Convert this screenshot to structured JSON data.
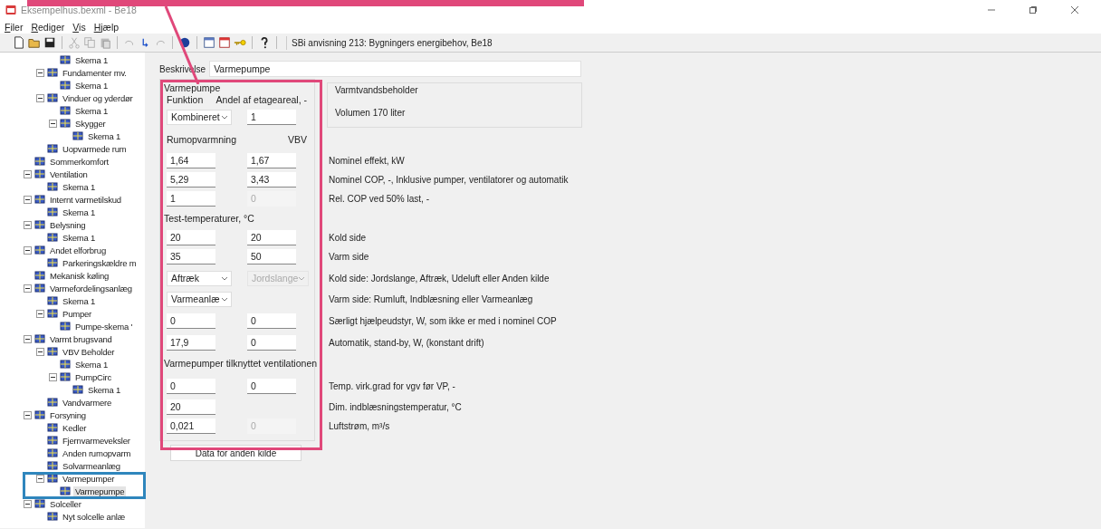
{
  "window": {
    "title": "Eksempelhus.bexml - Be18"
  },
  "menu": [
    "Filer",
    "Rediger",
    "Vis",
    "Hjælp"
  ],
  "toolbar": {
    "reference": "SBi anvisning 213: Bygningers energibehov, Be18"
  },
  "tree": {
    "items": [
      {
        "children": [
          {
            "children": [
              {
                "label": "Skema 1",
                "selected": false
              }
            ]
          },
          {
            "label": "Fundamenter mv.",
            "expanded": true,
            "selected": false,
            "children": [
              {
                "label": "Skema 1",
                "selected": false
              }
            ]
          },
          {
            "label": "Vinduer og yderdør",
            "expanded": true,
            "selected": false,
            "children": [
              {
                "label": "Skema 1",
                "selected": false
              },
              {
                "label": "Skygger",
                "expanded": true,
                "selected": false,
                "children": [
                  {
                    "label": "Skema 1",
                    "selected": false
                  }
                ]
              }
            ]
          },
          {
            "label": "Uopvarmede rum",
            "selected": false
          }
        ]
      },
      {
        "label": "Sommerkomfort",
        "selected": false
      },
      {
        "label": "Ventilation",
        "expanded": true,
        "selected": false,
        "children": [
          {
            "label": "Skema 1",
            "selected": false
          }
        ]
      },
      {
        "label": "Internt varmetilskud",
        "expanded": true,
        "selected": false,
        "children": [
          {
            "label": "Skema 1",
            "selected": false
          }
        ]
      },
      {
        "label": "Belysning",
        "expanded": true,
        "selected": false,
        "children": [
          {
            "label": "Skema 1",
            "selected": false
          }
        ]
      },
      {
        "label": "Andet elforbrug",
        "expanded": true,
        "selected": false,
        "children": [
          {
            "label": "Parkeringskældre m",
            "selected": false
          }
        ]
      },
      {
        "label": "Mekanisk køling",
        "selected": false
      },
      {
        "label": "Varmefordelingsanlæg",
        "expanded": true,
        "selected": false,
        "children": [
          {
            "label": "Skema 1",
            "selected": false
          },
          {
            "label": "Pumper",
            "expanded": true,
            "selected": false,
            "children": [
              {
                "label": "Pumpe-skema '",
                "selected": false
              }
            ]
          }
        ]
      },
      {
        "label": "Varmt brugsvand",
        "expanded": true,
        "selected": false,
        "children": [
          {
            "label": "VBV Beholder",
            "expanded": true,
            "selected": false,
            "children": [
              {
                "label": "Skema 1",
                "selected": false
              },
              {
                "label": "PumpCirc",
                "expanded": true,
                "selected": false,
                "children": [
                  {
                    "label": "Skema 1",
                    "selected": false
                  }
                ]
              }
            ]
          },
          {
            "label": "Vandvarmere",
            "selected": false
          }
        ]
      },
      {
        "label": "Forsyning",
        "expanded": true,
        "selected": false,
        "children": [
          {
            "label": "Kedler",
            "selected": false
          },
          {
            "label": "Fjernvarmeveksler",
            "selected": false
          },
          {
            "label": "Anden rumopvarm",
            "selected": false
          },
          {
            "label": "Solvarmeanlæg",
            "selected": false
          },
          {
            "label": "Varmepumper",
            "expanded": true,
            "selected": false,
            "children": [
              {
                "label": "Varmepumpe",
                "selected": true
              }
            ]
          }
        ]
      },
      {
        "label": "Solceller",
        "expanded": true,
        "selected": false,
        "children": [
          {
            "label": "Nyt solcelle anlæ",
            "selected": false
          }
        ]
      }
    ]
  },
  "description": {
    "label": "Beskrivelse",
    "value": "Varmepumpe"
  },
  "heat_pump": {
    "rows": [
      {
        "kind": "legend",
        "text": "Varmepumpe"
      },
      {
        "kind": "captions",
        "left": "Funktion",
        "right": "Andel af etageareal, -"
      },
      {
        "kind": "fields",
        "left": {
          "kind": "select",
          "value": "Kombineret",
          "disabled": false
        },
        "right": {
          "kind": "input",
          "value": "1",
          "disabled": false
        }
      },
      {
        "kind": "captions",
        "left": "Rumopvarmning",
        "right": "VBV"
      },
      {
        "kind": "fields",
        "left": {
          "kind": "input",
          "value": "1,64",
          "disabled": false
        },
        "right": {
          "kind": "input",
          "value": "1,67",
          "disabled": false
        },
        "label": "Nominel effekt, kW"
      },
      {
        "kind": "fields",
        "left": {
          "kind": "input",
          "value": "5,29",
          "disabled": false
        },
        "right": {
          "kind": "input",
          "value": "3,43",
          "disabled": false
        },
        "label": "Nominel COP, -, Inklusive pumper, ventilatorer og automatik"
      },
      {
        "kind": "fields",
        "left": {
          "kind": "input",
          "value": "1",
          "disabled": false
        },
        "right": {
          "kind": "input",
          "value": "0",
          "disabled": true
        },
        "label": "Rel. COP ved 50% last, -"
      },
      {
        "kind": "legend",
        "text": "Test-temperaturer, °C"
      },
      {
        "kind": "fields",
        "left": {
          "kind": "input",
          "value": "20",
          "disabled": false
        },
        "right": {
          "kind": "input",
          "value": "20",
          "disabled": false
        },
        "label": "Kold side"
      },
      {
        "kind": "fields",
        "left": {
          "kind": "input",
          "value": "35",
          "disabled": false
        },
        "right": {
          "kind": "input",
          "value": "50",
          "disabled": false
        },
        "label": "Varm side"
      },
      {
        "kind": "fields",
        "left": {
          "kind": "select",
          "value": "Aftræk",
          "disabled": false
        },
        "right": {
          "kind": "select",
          "value": "Jordslange",
          "disabled": true
        },
        "label": "Kold side: Jordslange, Aftræk, Udeluft eller Anden kilde"
      },
      {
        "kind": "fields",
        "left": {
          "kind": "select",
          "value": "Varmeanlæ",
          "disabled": false
        },
        "label": "Varm side: Rumluft, Indblæsning eller Varmeanlæg"
      },
      {
        "kind": "fields",
        "left": {
          "kind": "input",
          "value": "0",
          "disabled": false
        },
        "right": {
          "kind": "input",
          "value": "0",
          "disabled": false
        },
        "label": "Særligt hjælpeudstyr, W, som ikke er med i nominel COP"
      },
      {
        "kind": "fields",
        "left": {
          "kind": "input",
          "value": "17,9",
          "disabled": false
        },
        "right": {
          "kind": "input",
          "value": "0",
          "disabled": false
        },
        "label": "Automatik, stand-by, W, (konstant drift)"
      },
      {
        "kind": "legend",
        "text": "Varmepumper tilknyttet ventilationen"
      },
      {
        "kind": "fields",
        "left": {
          "kind": "input",
          "value": "0",
          "disabled": false
        },
        "right": {
          "kind": "input",
          "value": "0",
          "disabled": false
        },
        "label": "Temp. virk.grad for vgv før VP, -"
      },
      {
        "kind": "fields",
        "left": {
          "kind": "input",
          "value": "20",
          "disabled": false
        },
        "label": "Dim. indblæsningstemperatur, °C"
      },
      {
        "kind": "fields",
        "left": {
          "kind": "input",
          "value": "0,021",
          "disabled": false
        },
        "right": {
          "kind": "input",
          "value": "0",
          "disabled": true
        },
        "label": "Luftstrøm, m³/s"
      }
    ]
  },
  "water_tank": {
    "title": "Varmtvandsbeholder",
    "volume": "Volumen 170 liter"
  },
  "other_source_button": "Data for anden kilde",
  "annotations": [
    {
      "kind": "edge",
      "color": "#e0487a"
    },
    {
      "kind": "pointer",
      "color": "#e0487a"
    },
    {
      "kind": "frame",
      "color": "#e0487a"
    },
    {
      "kind": "frame",
      "color": "#2f86bd"
    }
  ]
}
